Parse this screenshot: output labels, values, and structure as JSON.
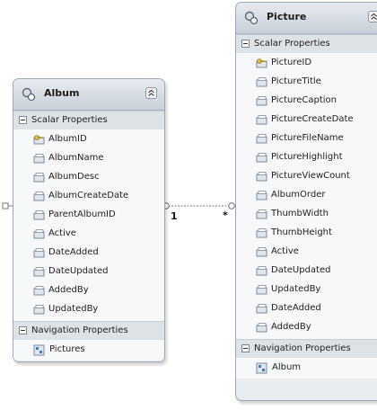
{
  "album": {
    "title": "Album",
    "scalar_label": "Scalar Properties",
    "properties": [
      "AlbumID",
      "AlbumName",
      "AlbumDesc",
      "AlbumCreateDate",
      "ParentAlbumID",
      "Active",
      "DateAdded",
      "DateUpdated",
      "AddedBy",
      "UpdatedBy"
    ],
    "navigation_label": "Navigation Properties",
    "navigation": [
      "Pictures"
    ]
  },
  "picture": {
    "title": "Picture",
    "scalar_label": "Scalar Properties",
    "properties": [
      "PictureID",
      "PictureTitle",
      "PictureCaption",
      "PictureCreateDate",
      "PictureFileName",
      "PictureHighlight",
      "PictureViewCount",
      "AlbumOrder",
      "ThumbWidth",
      "ThumbHeight",
      "Active",
      "DateUpdated",
      "UpdatedBy",
      "DateAdded",
      "AddedBy"
    ],
    "navigation_label": "Navigation Properties",
    "navigation": [
      "Album"
    ]
  },
  "association": {
    "left_multiplicity": "1",
    "right_multiplicity": "*"
  },
  "icons": {
    "entity": "entity-icon",
    "key": "key-property-icon",
    "property": "property-icon",
    "navigation": "navigation-property-icon",
    "collapse": "collapse-chevron-icon"
  }
}
